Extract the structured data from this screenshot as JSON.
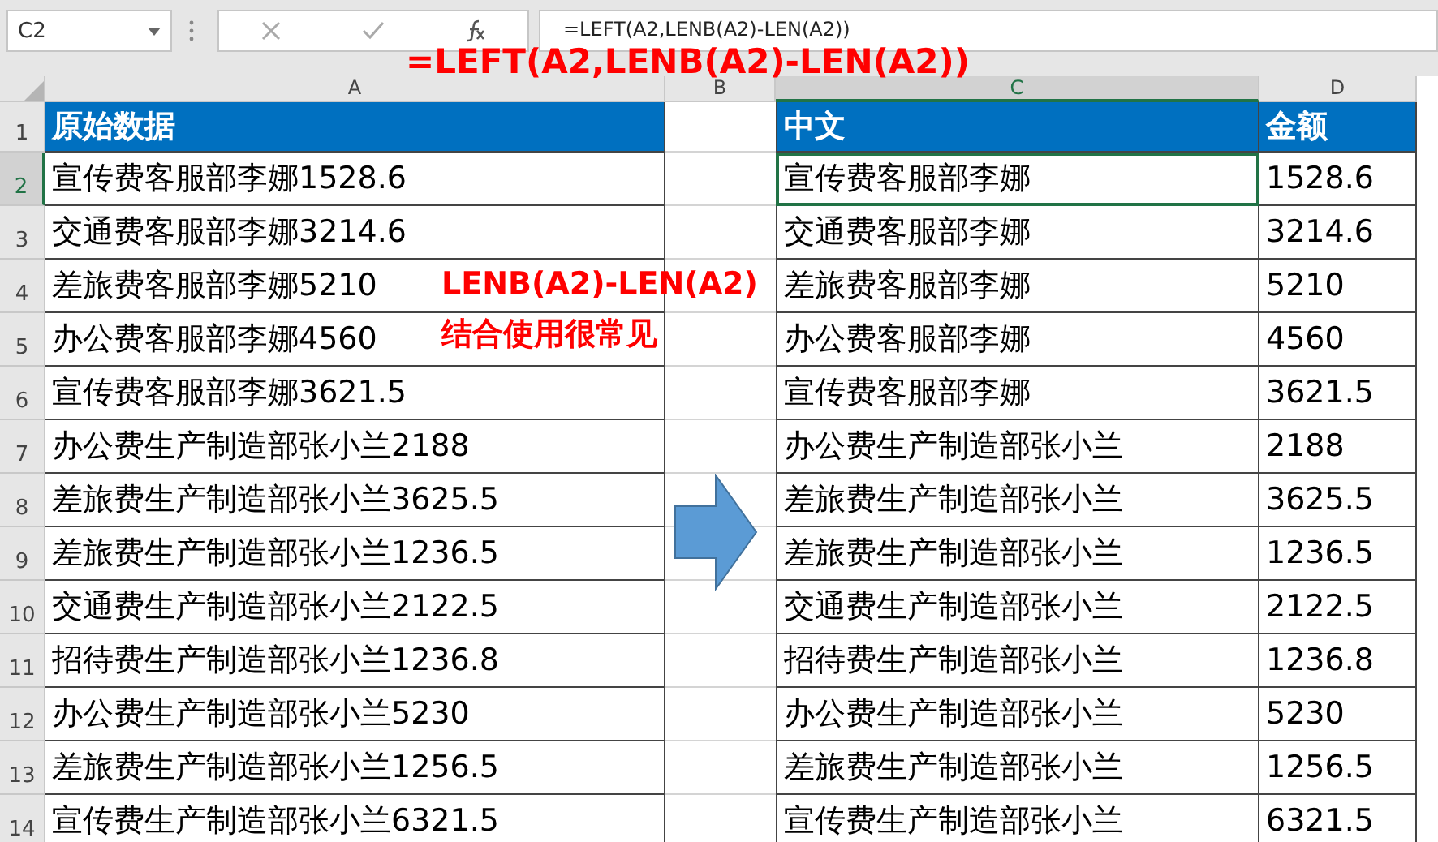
{
  "name_box": "C2",
  "formula_bar": {
    "formula": "=LEFT(A2,LENB(A2)-LEN(A2))"
  },
  "annotations": [
    {
      "text": "=LEFT(A2,LENB(A2)-LEN(A2))",
      "kind": "formula"
    },
    {
      "text": "LENB(A2)-LEN(A2)",
      "kind": "note"
    },
    {
      "text": "结合使用很常见",
      "kind": "note"
    }
  ],
  "columns": [
    {
      "label": "A",
      "selected": false
    },
    {
      "label": "B",
      "selected": false
    },
    {
      "label": "C",
      "selected": true
    },
    {
      "label": "D",
      "selected": false
    }
  ],
  "rows": [
    {
      "number": "1",
      "kind": "header",
      "selected": false,
      "source": "原始数据",
      "name": "中文",
      "amount": "金额"
    },
    {
      "number": "2",
      "kind": "data",
      "selected": true,
      "source": "宣传费客服部李娜1528.6",
      "name": "宣传费客服部李娜",
      "amount": "1528.6"
    },
    {
      "number": "3",
      "kind": "data",
      "selected": false,
      "source": "交通费客服部李娜3214.6",
      "name": "交通费客服部李娜",
      "amount": "3214.6"
    },
    {
      "number": "4",
      "kind": "data",
      "selected": false,
      "source": "差旅费客服部李娜5210",
      "name": "差旅费客服部李娜",
      "amount": "5210"
    },
    {
      "number": "5",
      "kind": "data",
      "selected": false,
      "source": "办公费客服部李娜4560",
      "name": "办公费客服部李娜",
      "amount": "4560"
    },
    {
      "number": "6",
      "kind": "data",
      "selected": false,
      "source": "宣传费客服部李娜3621.5",
      "name": "宣传费客服部李娜",
      "amount": "3621.5"
    },
    {
      "number": "7",
      "kind": "data",
      "selected": false,
      "source": "办公费生产制造部张小兰2188",
      "name": "办公费生产制造部张小兰",
      "amount": "2188"
    },
    {
      "number": "8",
      "kind": "data",
      "selected": false,
      "source": "差旅费生产制造部张小兰3625.5",
      "name": "差旅费生产制造部张小兰",
      "amount": "3625.5"
    },
    {
      "number": "9",
      "kind": "data",
      "selected": false,
      "source": "差旅费生产制造部张小兰1236.5",
      "name": "差旅费生产制造部张小兰",
      "amount": "1236.5"
    },
    {
      "number": "10",
      "kind": "data",
      "selected": false,
      "source": "交通费生产制造部张小兰2122.5",
      "name": "交通费生产制造部张小兰",
      "amount": "2122.5"
    },
    {
      "number": "11",
      "kind": "data",
      "selected": false,
      "source": "招待费生产制造部张小兰1236.8",
      "name": "招待费生产制造部张小兰",
      "amount": "1236.8"
    },
    {
      "number": "12",
      "kind": "data",
      "selected": false,
      "source": "办公费生产制造部张小兰5230",
      "name": "办公费生产制造部张小兰",
      "amount": "5230"
    },
    {
      "number": "13",
      "kind": "data",
      "selected": false,
      "source": "差旅费生产制造部张小兰1256.5",
      "name": "差旅费生产制造部张小兰",
      "amount": "1256.5"
    },
    {
      "number": "14",
      "kind": "data",
      "selected": false,
      "source": "宣传费生产制造部张小兰6321.5",
      "name": "宣传费生产制造部张小兰",
      "amount": "6321.5"
    }
  ]
}
